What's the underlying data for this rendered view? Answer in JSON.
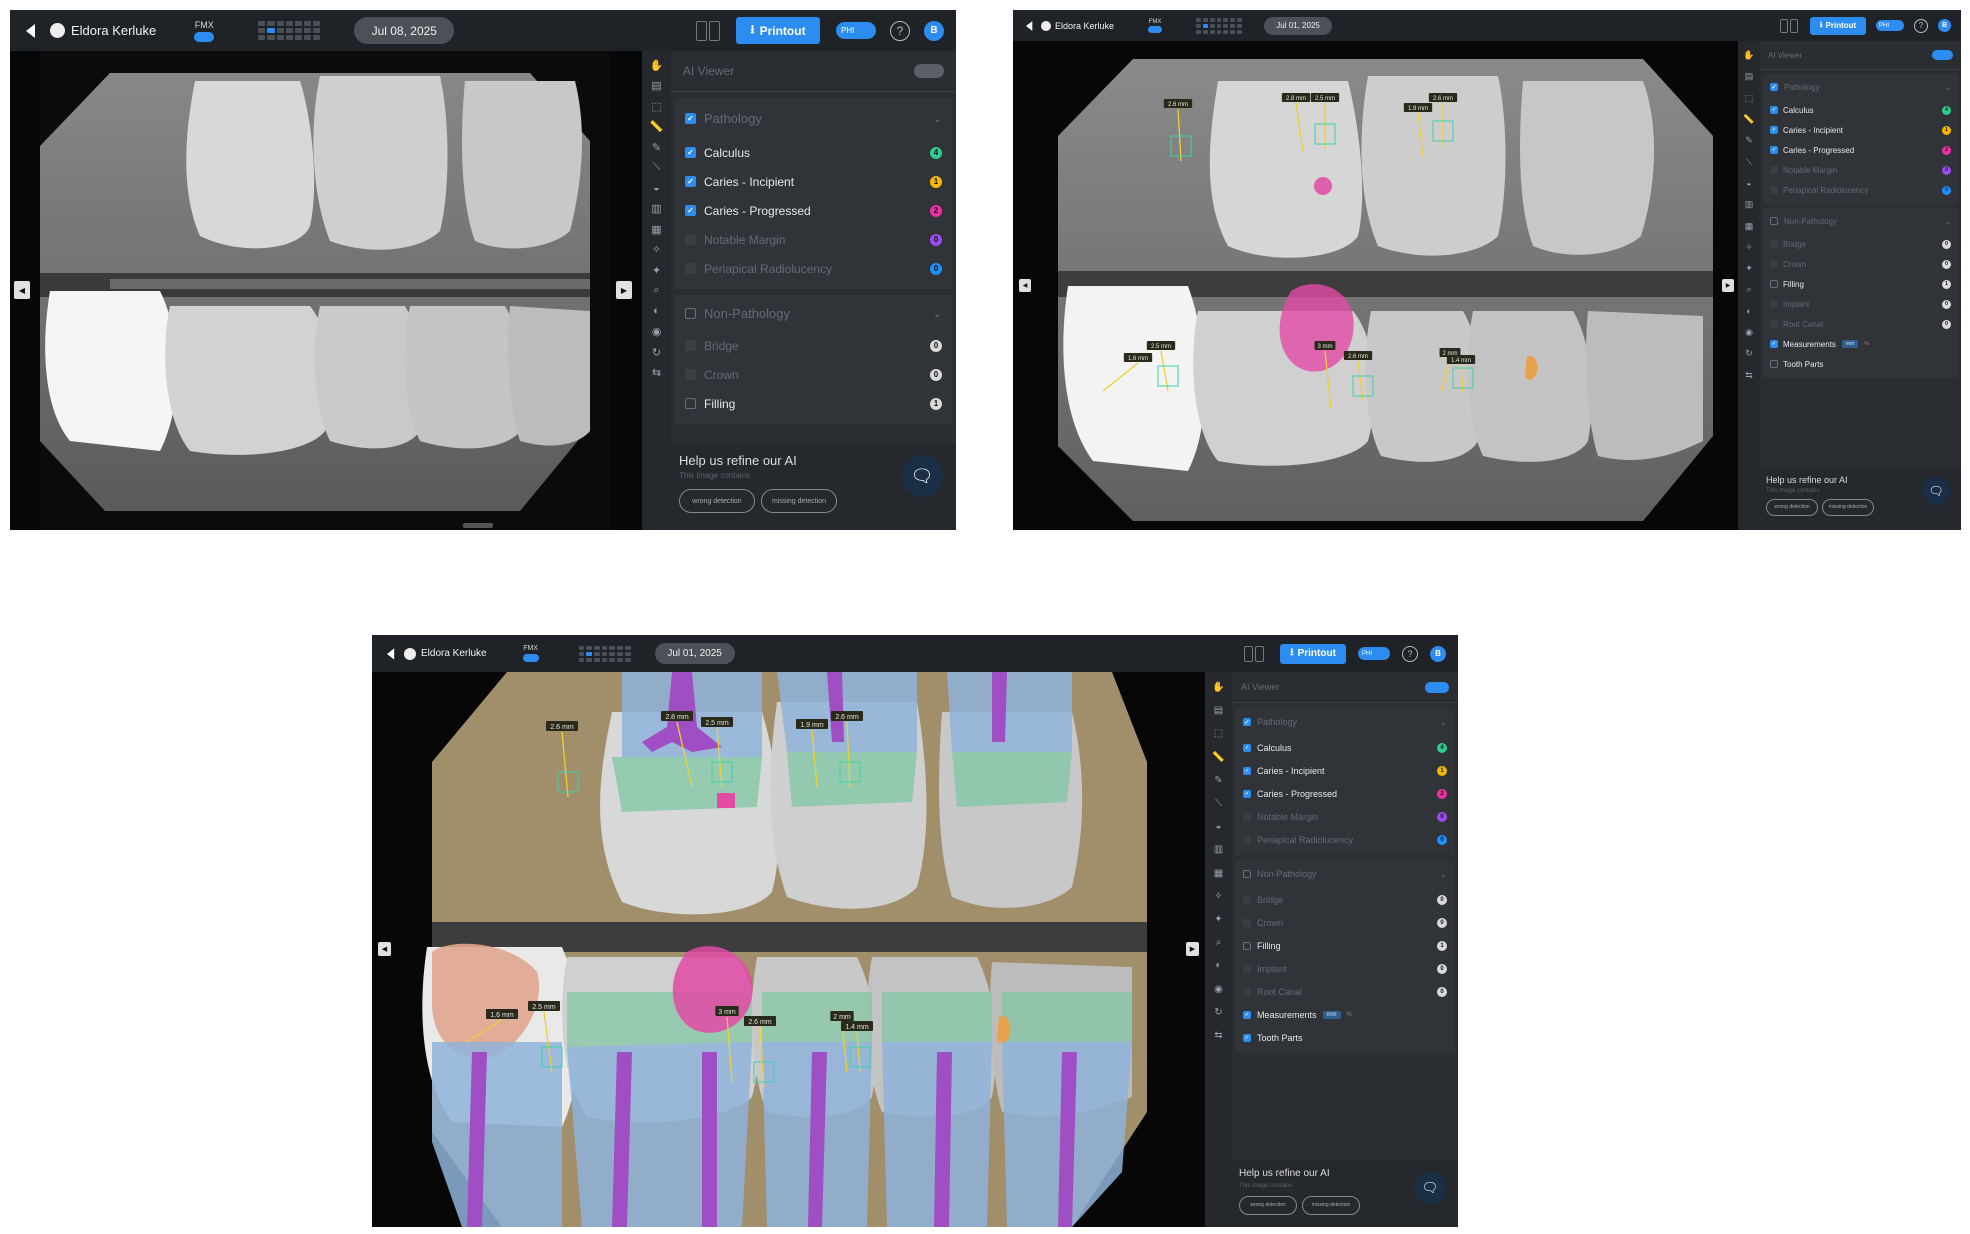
{
  "colors": {
    "accent": "#2d8cf0",
    "calculus": "#2ecc8f",
    "caries_incipient": "#f5b700",
    "caries_progressed": "#ee2fa6",
    "notable_margin": "#9b4df0",
    "periapical_radiolucency": "#1e90ff",
    "neutral_count": "#d9d9d9"
  },
  "screens": [
    {
      "header": {
        "patient_name": "Eldora Kerluke",
        "fmx_label": "FMX",
        "date": "Jul 08, 2025",
        "printout_label": "Printout",
        "phi_label": "PHI",
        "help_icon": "question-circle-icon",
        "avatar_initial": "B"
      },
      "sidebar": {
        "ai_viewer_label": "AI Viewer",
        "ai_viewer_on": false,
        "pathology_label": "Pathology",
        "pathology_items": [
          {
            "label": "Calculus",
            "count": "4",
            "checked": true
          },
          {
            "label": "Caries - Incipient",
            "count": "1",
            "checked": true
          },
          {
            "label": "Caries - Progressed",
            "count": "2",
            "checked": true
          },
          {
            "label": "Notable Margin",
            "count": "0",
            "checked": false
          },
          {
            "label": "Periapical Radiolucency",
            "count": "0",
            "checked": false
          }
        ],
        "non_pathology_label": "Non-Pathology",
        "non_pathology_items": [
          {
            "label": "Bridge",
            "count": "0",
            "checked": false
          },
          {
            "label": "Crown",
            "count": "0",
            "checked": false
          },
          {
            "label": "Filling",
            "count": "1",
            "checked": false
          }
        ]
      },
      "help": {
        "title": "Help us refine our AI",
        "subtitle": "This image contains",
        "wrong": "wrong detection",
        "missing": "missing detection"
      }
    },
    {
      "header": {
        "patient_name": "Eldora Kerluke",
        "fmx_label": "FMX",
        "date": "Jul 01, 2025",
        "printout_label": "Printout",
        "phi_label": "PHI",
        "help_icon": "question-circle-icon",
        "avatar_initial": "B"
      },
      "sidebar": {
        "ai_viewer_label": "AI Viewer",
        "ai_viewer_on": true,
        "pathology_label": "Pathology",
        "pathology_items": [
          {
            "label": "Calculus",
            "count": "4",
            "checked": true
          },
          {
            "label": "Caries - Incipient",
            "count": "1",
            "checked": true
          },
          {
            "label": "Caries - Progressed",
            "count": "2",
            "checked": true
          },
          {
            "label": "Notable Margin",
            "count": "0",
            "checked": false
          },
          {
            "label": "Periapical Radiolucency",
            "count": "0",
            "checked": false
          }
        ],
        "non_pathology_label": "Non-Pathology",
        "non_pathology_items": [
          {
            "label": "Bridge",
            "count": "0",
            "checked": false
          },
          {
            "label": "Crown",
            "count": "0",
            "checked": false
          },
          {
            "label": "Filling",
            "count": "1",
            "checked": false
          },
          {
            "label": "Implant",
            "count": "0",
            "checked": false
          },
          {
            "label": "Root Canal",
            "count": "0",
            "checked": false
          }
        ],
        "extra_items": [
          {
            "label": "Measurements",
            "unit_a": "mm",
            "unit_b": "%",
            "checked": true
          },
          {
            "label": "Tooth Parts",
            "checked": false
          }
        ]
      },
      "measurements": [
        "2.6 mm",
        "2.8 mm",
        "2.5 mm",
        "1.9 mm",
        "2.6 mm",
        "1.6 mm",
        "2.5 mm",
        "3 mm",
        "2.6 mm",
        "2 mm",
        "1.4 mm"
      ],
      "help": {
        "title": "Help us refine our AI",
        "subtitle": "This image contains",
        "wrong": "wrong detection",
        "missing": "missing detection"
      }
    },
    {
      "header": {
        "patient_name": "Eldora Kerluke",
        "fmx_label": "FMX",
        "date": "Jul 01, 2025",
        "printout_label": "Printout",
        "phi_label": "PHI",
        "help_icon": "question-circle-icon",
        "avatar_initial": "B"
      },
      "sidebar": {
        "ai_viewer_label": "AI Viewer",
        "ai_viewer_on": true,
        "pathology_label": "Pathology",
        "pathology_items": [
          {
            "label": "Calculus",
            "count": "4",
            "checked": true
          },
          {
            "label": "Caries - Incipient",
            "count": "1",
            "checked": true
          },
          {
            "label": "Caries - Progressed",
            "count": "2",
            "checked": true
          },
          {
            "label": "Notable Margin",
            "count": "0",
            "checked": false
          },
          {
            "label": "Periapical Radiolucency",
            "count": "0",
            "checked": false
          }
        ],
        "non_pathology_label": "Non-Pathology",
        "non_pathology_items": [
          {
            "label": "Bridge",
            "count": "0",
            "checked": false
          },
          {
            "label": "Crown",
            "count": "0",
            "checked": false
          },
          {
            "label": "Filling",
            "count": "1",
            "checked": false
          },
          {
            "label": "Implant",
            "count": "0",
            "checked": false
          },
          {
            "label": "Root Canal",
            "count": "0",
            "checked": false
          }
        ],
        "extra_items": [
          {
            "label": "Measurements",
            "unit_a": "mm",
            "unit_b": "%",
            "checked": true
          },
          {
            "label": "Tooth Parts",
            "checked": true
          }
        ]
      },
      "measurements": [
        "2.6 mm",
        "2.8 mm",
        "2.5 mm",
        "1.9 mm",
        "2.6 mm",
        "1.6 mm",
        "2.5 mm",
        "3 mm",
        "2.6 mm",
        "2 mm",
        "1.4 mm"
      ],
      "help": {
        "title": "Help us refine our AI",
        "subtitle": "This image contains",
        "wrong": "wrong detection",
        "missing": "missing detection"
      }
    }
  ]
}
